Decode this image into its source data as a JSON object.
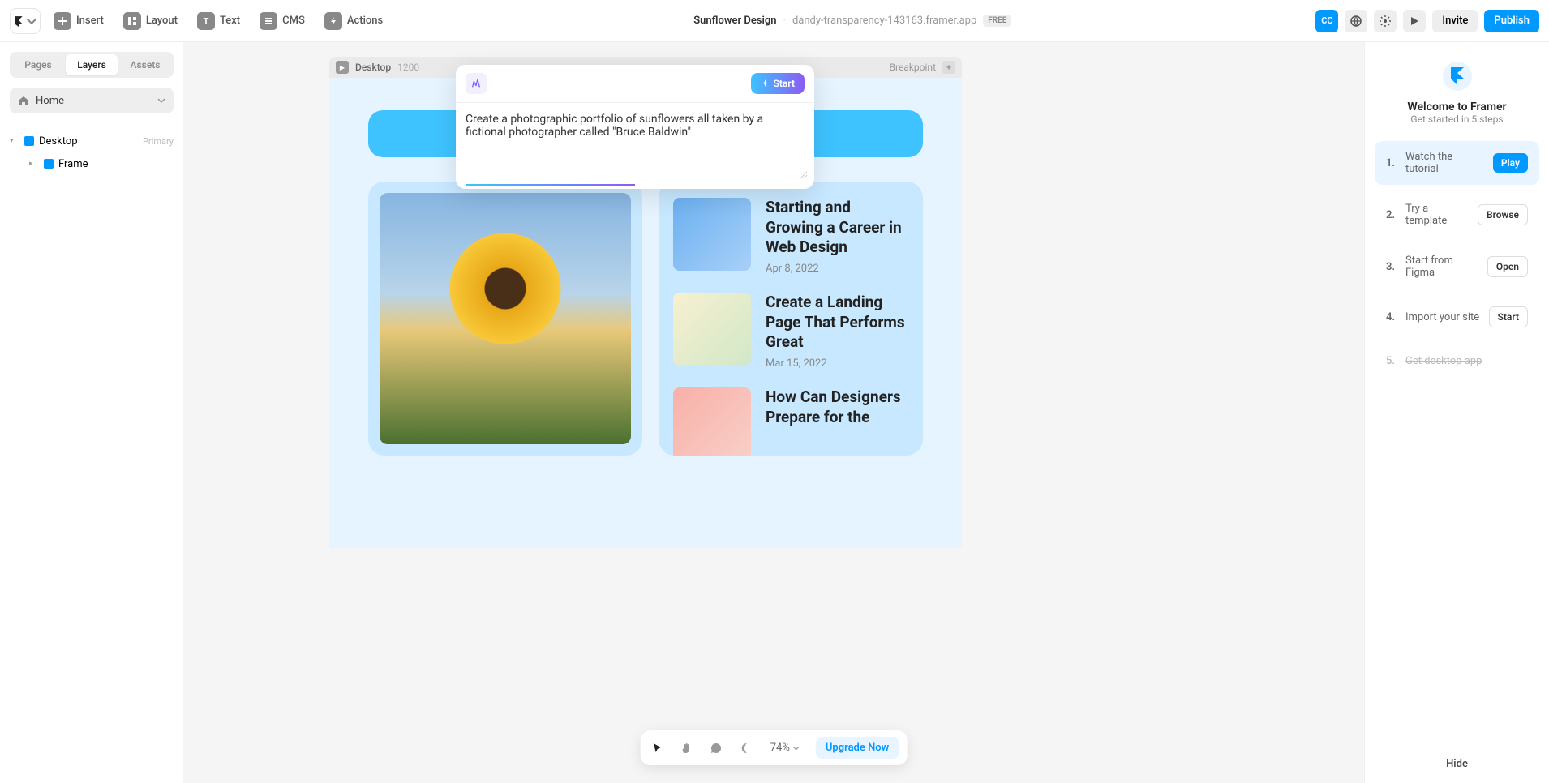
{
  "topbar": {
    "insert": "Insert",
    "layout": "Layout",
    "text": "Text",
    "cms": "CMS",
    "actions": "Actions",
    "project_name": "Sunflower Design",
    "project_url": "dandy-transparency-143163.framer.app",
    "free_badge": "FREE",
    "cc": "CC",
    "invite": "Invite",
    "publish": "Publish"
  },
  "left": {
    "tabs": {
      "pages": "Pages",
      "layers": "Layers",
      "assets": "Assets"
    },
    "home": "Home",
    "tree": {
      "desktop": "Desktop",
      "primary": "Primary",
      "frame": "Frame"
    }
  },
  "canvas": {
    "header": {
      "name": "Desktop",
      "size": "1200",
      "breakpoint": "Breakpoint"
    },
    "articles": [
      {
        "title": "Starting and Growing a Career in Web Design",
        "date": "Apr 8, 2022"
      },
      {
        "title": "Create a Landing Page That Performs Great",
        "date": "Mar 15, 2022"
      },
      {
        "title": "How Can Designers Prepare for the",
        "date": ""
      }
    ]
  },
  "ai": {
    "start": "Start",
    "prompt": "Create a photographic portfolio of sunflowers all taken by a fictional photographer called \"Bruce Baldwin\""
  },
  "bottom": {
    "zoom": "74%",
    "upgrade": "Upgrade Now"
  },
  "right": {
    "title": "Welcome to Framer",
    "subtitle": "Get started in 5 steps",
    "steps": [
      {
        "num": "1.",
        "label": "Watch the tutorial",
        "action": "Play"
      },
      {
        "num": "2.",
        "label": "Try a template",
        "action": "Browse"
      },
      {
        "num": "3.",
        "label": "Start from Figma",
        "action": "Open"
      },
      {
        "num": "4.",
        "label": "Import your site",
        "action": "Start"
      },
      {
        "num": "5.",
        "label": "Get desktop app",
        "action": ""
      }
    ],
    "hide": "Hide"
  }
}
